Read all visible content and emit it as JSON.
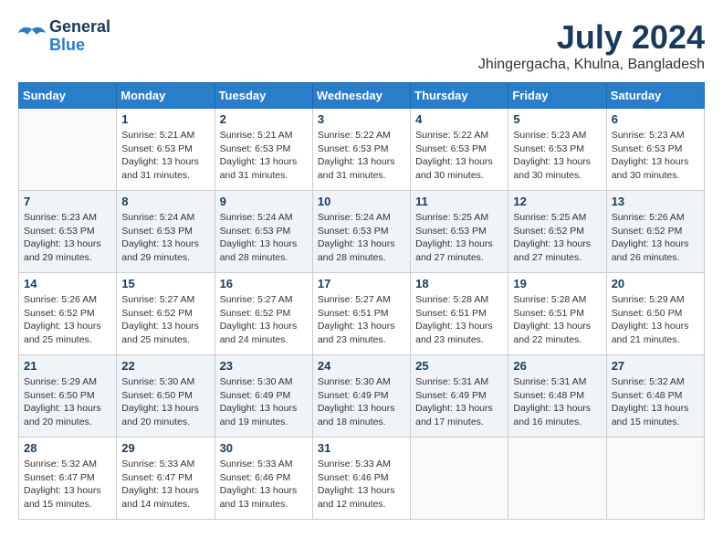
{
  "logo": {
    "line1": "General",
    "line2": "Blue"
  },
  "header": {
    "month_year": "July 2024",
    "location": "Jhingergacha, Khulna, Bangladesh"
  },
  "weekdays": [
    "Sunday",
    "Monday",
    "Tuesday",
    "Wednesday",
    "Thursday",
    "Friday",
    "Saturday"
  ],
  "weeks": [
    [
      {
        "day": "",
        "sunrise": "",
        "sunset": "",
        "daylight": ""
      },
      {
        "day": "1",
        "sunrise": "Sunrise: 5:21 AM",
        "sunset": "Sunset: 6:53 PM",
        "daylight": "Daylight: 13 hours and 31 minutes."
      },
      {
        "day": "2",
        "sunrise": "Sunrise: 5:21 AM",
        "sunset": "Sunset: 6:53 PM",
        "daylight": "Daylight: 13 hours and 31 minutes."
      },
      {
        "day": "3",
        "sunrise": "Sunrise: 5:22 AM",
        "sunset": "Sunset: 6:53 PM",
        "daylight": "Daylight: 13 hours and 31 minutes."
      },
      {
        "day": "4",
        "sunrise": "Sunrise: 5:22 AM",
        "sunset": "Sunset: 6:53 PM",
        "daylight": "Daylight: 13 hours and 30 minutes."
      },
      {
        "day": "5",
        "sunrise": "Sunrise: 5:23 AM",
        "sunset": "Sunset: 6:53 PM",
        "daylight": "Daylight: 13 hours and 30 minutes."
      },
      {
        "day": "6",
        "sunrise": "Sunrise: 5:23 AM",
        "sunset": "Sunset: 6:53 PM",
        "daylight": "Daylight: 13 hours and 30 minutes."
      }
    ],
    [
      {
        "day": "7",
        "sunrise": "Sunrise: 5:23 AM",
        "sunset": "Sunset: 6:53 PM",
        "daylight": "Daylight: 13 hours and 29 minutes."
      },
      {
        "day": "8",
        "sunrise": "Sunrise: 5:24 AM",
        "sunset": "Sunset: 6:53 PM",
        "daylight": "Daylight: 13 hours and 29 minutes."
      },
      {
        "day": "9",
        "sunrise": "Sunrise: 5:24 AM",
        "sunset": "Sunset: 6:53 PM",
        "daylight": "Daylight: 13 hours and 28 minutes."
      },
      {
        "day": "10",
        "sunrise": "Sunrise: 5:24 AM",
        "sunset": "Sunset: 6:53 PM",
        "daylight": "Daylight: 13 hours and 28 minutes."
      },
      {
        "day": "11",
        "sunrise": "Sunrise: 5:25 AM",
        "sunset": "Sunset: 6:53 PM",
        "daylight": "Daylight: 13 hours and 27 minutes."
      },
      {
        "day": "12",
        "sunrise": "Sunrise: 5:25 AM",
        "sunset": "Sunset: 6:52 PM",
        "daylight": "Daylight: 13 hours and 27 minutes."
      },
      {
        "day": "13",
        "sunrise": "Sunrise: 5:26 AM",
        "sunset": "Sunset: 6:52 PM",
        "daylight": "Daylight: 13 hours and 26 minutes."
      }
    ],
    [
      {
        "day": "14",
        "sunrise": "Sunrise: 5:26 AM",
        "sunset": "Sunset: 6:52 PM",
        "daylight": "Daylight: 13 hours and 25 minutes."
      },
      {
        "day": "15",
        "sunrise": "Sunrise: 5:27 AM",
        "sunset": "Sunset: 6:52 PM",
        "daylight": "Daylight: 13 hours and 25 minutes."
      },
      {
        "day": "16",
        "sunrise": "Sunrise: 5:27 AM",
        "sunset": "Sunset: 6:52 PM",
        "daylight": "Daylight: 13 hours and 24 minutes."
      },
      {
        "day": "17",
        "sunrise": "Sunrise: 5:27 AM",
        "sunset": "Sunset: 6:51 PM",
        "daylight": "Daylight: 13 hours and 23 minutes."
      },
      {
        "day": "18",
        "sunrise": "Sunrise: 5:28 AM",
        "sunset": "Sunset: 6:51 PM",
        "daylight": "Daylight: 13 hours and 23 minutes."
      },
      {
        "day": "19",
        "sunrise": "Sunrise: 5:28 AM",
        "sunset": "Sunset: 6:51 PM",
        "daylight": "Daylight: 13 hours and 22 minutes."
      },
      {
        "day": "20",
        "sunrise": "Sunrise: 5:29 AM",
        "sunset": "Sunset: 6:50 PM",
        "daylight": "Daylight: 13 hours and 21 minutes."
      }
    ],
    [
      {
        "day": "21",
        "sunrise": "Sunrise: 5:29 AM",
        "sunset": "Sunset: 6:50 PM",
        "daylight": "Daylight: 13 hours and 20 minutes."
      },
      {
        "day": "22",
        "sunrise": "Sunrise: 5:30 AM",
        "sunset": "Sunset: 6:50 PM",
        "daylight": "Daylight: 13 hours and 20 minutes."
      },
      {
        "day": "23",
        "sunrise": "Sunrise: 5:30 AM",
        "sunset": "Sunset: 6:49 PM",
        "daylight": "Daylight: 13 hours and 19 minutes."
      },
      {
        "day": "24",
        "sunrise": "Sunrise: 5:30 AM",
        "sunset": "Sunset: 6:49 PM",
        "daylight": "Daylight: 13 hours and 18 minutes."
      },
      {
        "day": "25",
        "sunrise": "Sunrise: 5:31 AM",
        "sunset": "Sunset: 6:49 PM",
        "daylight": "Daylight: 13 hours and 17 minutes."
      },
      {
        "day": "26",
        "sunrise": "Sunrise: 5:31 AM",
        "sunset": "Sunset: 6:48 PM",
        "daylight": "Daylight: 13 hours and 16 minutes."
      },
      {
        "day": "27",
        "sunrise": "Sunrise: 5:32 AM",
        "sunset": "Sunset: 6:48 PM",
        "daylight": "Daylight: 13 hours and 15 minutes."
      }
    ],
    [
      {
        "day": "28",
        "sunrise": "Sunrise: 5:32 AM",
        "sunset": "Sunset: 6:47 PM",
        "daylight": "Daylight: 13 hours and 15 minutes."
      },
      {
        "day": "29",
        "sunrise": "Sunrise: 5:33 AM",
        "sunset": "Sunset: 6:47 PM",
        "daylight": "Daylight: 13 hours and 14 minutes."
      },
      {
        "day": "30",
        "sunrise": "Sunrise: 5:33 AM",
        "sunset": "Sunset: 6:46 PM",
        "daylight": "Daylight: 13 hours and 13 minutes."
      },
      {
        "day": "31",
        "sunrise": "Sunrise: 5:33 AM",
        "sunset": "Sunset: 6:46 PM",
        "daylight": "Daylight: 13 hours and 12 minutes."
      },
      {
        "day": "",
        "sunrise": "",
        "sunset": "",
        "daylight": ""
      },
      {
        "day": "",
        "sunrise": "",
        "sunset": "",
        "daylight": ""
      },
      {
        "day": "",
        "sunrise": "",
        "sunset": "",
        "daylight": ""
      }
    ]
  ]
}
